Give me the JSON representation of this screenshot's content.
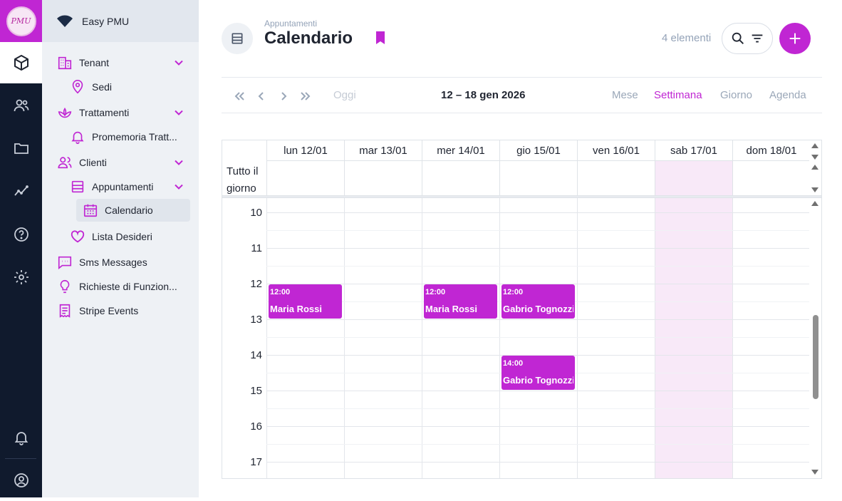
{
  "app": {
    "name": "Easy PMU",
    "logo_text": "PMU"
  },
  "colors": {
    "accent": "#c026d3",
    "rail": "#101a2d",
    "sidebar": "#eef1f5",
    "muted": "#94a3b8"
  },
  "rail": {
    "items": [
      {
        "icon": "cube-icon",
        "active": true
      },
      {
        "icon": "users-icon",
        "active": false
      },
      {
        "icon": "folder-icon",
        "active": false
      },
      {
        "icon": "analytics-icon",
        "active": false
      },
      {
        "icon": "help-icon",
        "active": false
      },
      {
        "icon": "settings-icon",
        "active": false
      }
    ],
    "bottom": [
      {
        "icon": "bell-icon"
      },
      {
        "icon": "account-icon"
      }
    ]
  },
  "sidebar": {
    "items": [
      {
        "label": "Tenant",
        "icon": "building-icon",
        "expandable": true
      },
      {
        "label": "Sedi",
        "icon": "location-icon"
      },
      {
        "label": "Trattamenti",
        "icon": "lotus-icon",
        "expandable": true
      },
      {
        "label": "Promemoria Tratt...",
        "icon": "bell-icon"
      },
      {
        "label": "Clienti",
        "icon": "people-icon",
        "expandable": true
      },
      {
        "label": "Appuntamenti",
        "icon": "list-icon",
        "expandable": true
      },
      {
        "label": "Calendario",
        "icon": "calendar-icon",
        "selected": true
      },
      {
        "label": "Lista Desideri",
        "icon": "heart-icon"
      },
      {
        "label": "Sms Messages",
        "icon": "message-icon"
      },
      {
        "label": "Richieste di Funzion...",
        "icon": "lightbulb-icon"
      },
      {
        "label": "Stripe Events",
        "icon": "receipt-icon"
      }
    ]
  },
  "header": {
    "breadcrumb": "Appuntamenti",
    "title": "Calendario",
    "count": "4 elementi"
  },
  "toolbar": {
    "today": "Oggi",
    "range": "12 – 18 gen 2026",
    "views": [
      "Mese",
      "Settimana",
      "Giorno",
      "Agenda"
    ],
    "active_view": "Settimana"
  },
  "calendar": {
    "days": [
      "lun 12/01",
      "mar 13/01",
      "mer 14/01",
      "gio 15/01",
      "ven 16/01",
      "sab 17/01",
      "dom 18/01"
    ],
    "highlighted_day": "sab 17/01",
    "all_day_label": "Tutto il giorno",
    "hours": [
      "10",
      "11",
      "12",
      "13",
      "14",
      "15",
      "16",
      "17"
    ],
    "events": [
      {
        "day": "lun 12/01",
        "time": "12:00",
        "title": "Maria Rossi"
      },
      {
        "day": "mer 14/01",
        "time": "12:00",
        "title": "Maria Rossi"
      },
      {
        "day": "gio 15/01",
        "time": "12:00",
        "title": "Gabrio Tognozzi"
      },
      {
        "day": "gio 15/01",
        "time": "14:00",
        "title": "Gabrio Tognozzi"
      }
    ]
  }
}
